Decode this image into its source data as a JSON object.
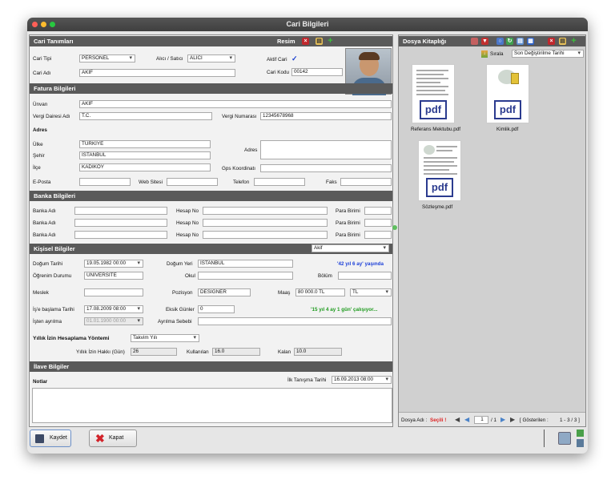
{
  "window": {
    "title": "Cari Bilgileri"
  },
  "cari": {
    "header": "Cari Tanımları",
    "resim_label": "Resim",
    "tip_label": "Cari Tipi",
    "tip_value": "PERSONEL",
    "alici_label": "Alıcı / Satıcı",
    "alici_value": "ALICI",
    "aktif_label": "Aktif Cari",
    "aktif_check": "✓",
    "adi_label": "Cari Adı",
    "adi_value": "AKİF",
    "kodu_label": "Cari Kodu",
    "kodu_value": "00142"
  },
  "fatura": {
    "header": "Fatura Bilgileri",
    "unvan_label": "Ünvan",
    "unvan_value": "AKİF",
    "vd_label": "Vergi Dairesi Adı",
    "vd_value": "T.C.",
    "vn_label": "Vergi Numarası",
    "vn_value": "12345678968",
    "adres_header": "Adres",
    "ulke_label": "Ülke",
    "ulke_value": "TÜRKİYE",
    "sehir_label": "Şehir",
    "sehir_value": "İSTANBUL",
    "ilce_label": "İlçe",
    "ilce_value": "KADIKÖY",
    "adres_label": "Adres",
    "gps_label": "Gps Koordinatı",
    "eposta_label": "E-Posta",
    "web_label": "Web Sitesi",
    "tel_label": "Telefon",
    "faks_label": "Faks"
  },
  "banka": {
    "header": "Banka Bilgileri",
    "adi_label": "Banka Adı",
    "hesap_label": "Hesap No",
    "para_label": "Para Birimi"
  },
  "kisisel": {
    "header": "Kişisel Bilgiler",
    "select_value": "Akif",
    "dogum_label": "Doğum Tarihi",
    "dogum_value": "19.05.1982 00:00",
    "yeri_label": "Doğum Yeri",
    "yeri_value": "İSTANBUL",
    "yas_text": "'42 yıl 6 ay'  yaşında",
    "ogrenim_label": "Öğrenim Durumu",
    "ogrenim_value": "ÜNİVERSİTE",
    "okul_label": "Okul",
    "bolum_label": "Bölüm",
    "meslek_label": "Meslek",
    "pozisyon_label": "Pozisyon",
    "pozisyon_value": "DESIGNER",
    "maas_label": "Maaş",
    "maas_value": "80 000.0 TL",
    "para_value": "TL",
    "baslama_label": "İş'e başlama Tarihi",
    "baslama_value": "17.08.2009 08:00",
    "eksik_label": "Eksik Günler",
    "eksik_value": "0",
    "calisma_text": "'15 yıl 4 ay 1 gün'  çalışıyor...",
    "ayrilma_label": "İşten ayrılma",
    "ayrilma_value": "01.01.1900 00:00",
    "sebep_label": "Ayrılma Sebebi",
    "izin_label": "Yıllık İzin Hesaplama Yöntemi",
    "izin_value": "Takvim Yılı",
    "hakki_label": "Yıllık İzin Hakkı (Gün)",
    "hakki_value": "26",
    "kullanilan_label": "Kullanılan",
    "kullanilan_value": "16.0",
    "kalan_label": "Kalan",
    "kalan_value": "10.0"
  },
  "ilave": {
    "header": "İlave Bilgiler",
    "notlar_label": "Notlar",
    "tanisma_label": "İlk Tanışma Tarihi",
    "tanisma_value": "16.09.2013 08:00"
  },
  "dosya": {
    "header": "Dosya Kitaplığı",
    "sirala_label": "Sırala",
    "sort_value": "Son Değiştirilme Tarihi",
    "files": [
      {
        "name": "Referans Mektubu.pdf"
      },
      {
        "name": "Kimlik.pdf"
      },
      {
        "name": "Sözleşme.pdf"
      }
    ],
    "pdf_text": "pdf",
    "footer_label": "Dosya Adı :",
    "footer_sel": "Seçili !",
    "page_value": "1",
    "page_total": "/ 1",
    "shown_label": "[ Gösterilen :",
    "shown_value": "1 - 3 / 3 ]"
  },
  "buttons": {
    "kaydet": "Kaydet",
    "kapat": "Kapat"
  }
}
